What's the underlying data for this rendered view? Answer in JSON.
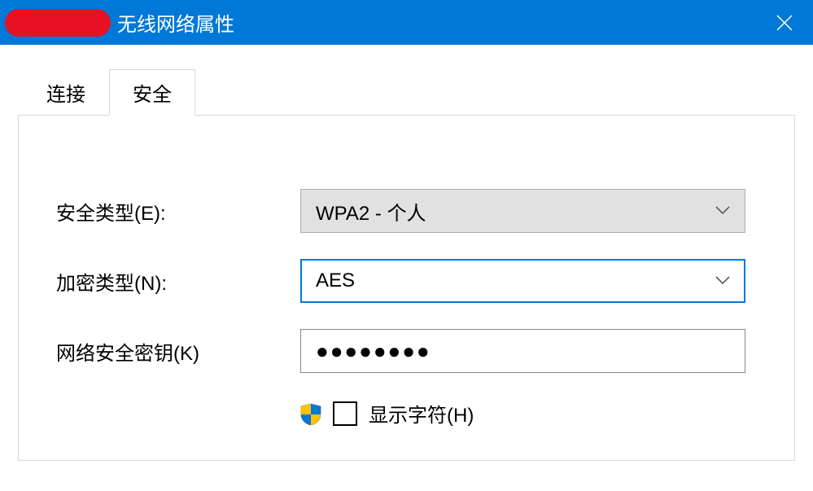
{
  "window": {
    "title": "无线网络属性"
  },
  "tabs": {
    "connection": "连接",
    "security": "安全"
  },
  "form": {
    "securityTypeLabel": "安全类型(E):",
    "securityTypeValue": "WPA2 - 个人",
    "encryptionTypeLabel": "加密类型(N):",
    "encryptionTypeValue": "AES",
    "networkKeyLabel": "网络安全密钥(K)",
    "networkKeyMasked": "●●●●●●●●",
    "showCharsLabel": "显示字符(H)"
  }
}
